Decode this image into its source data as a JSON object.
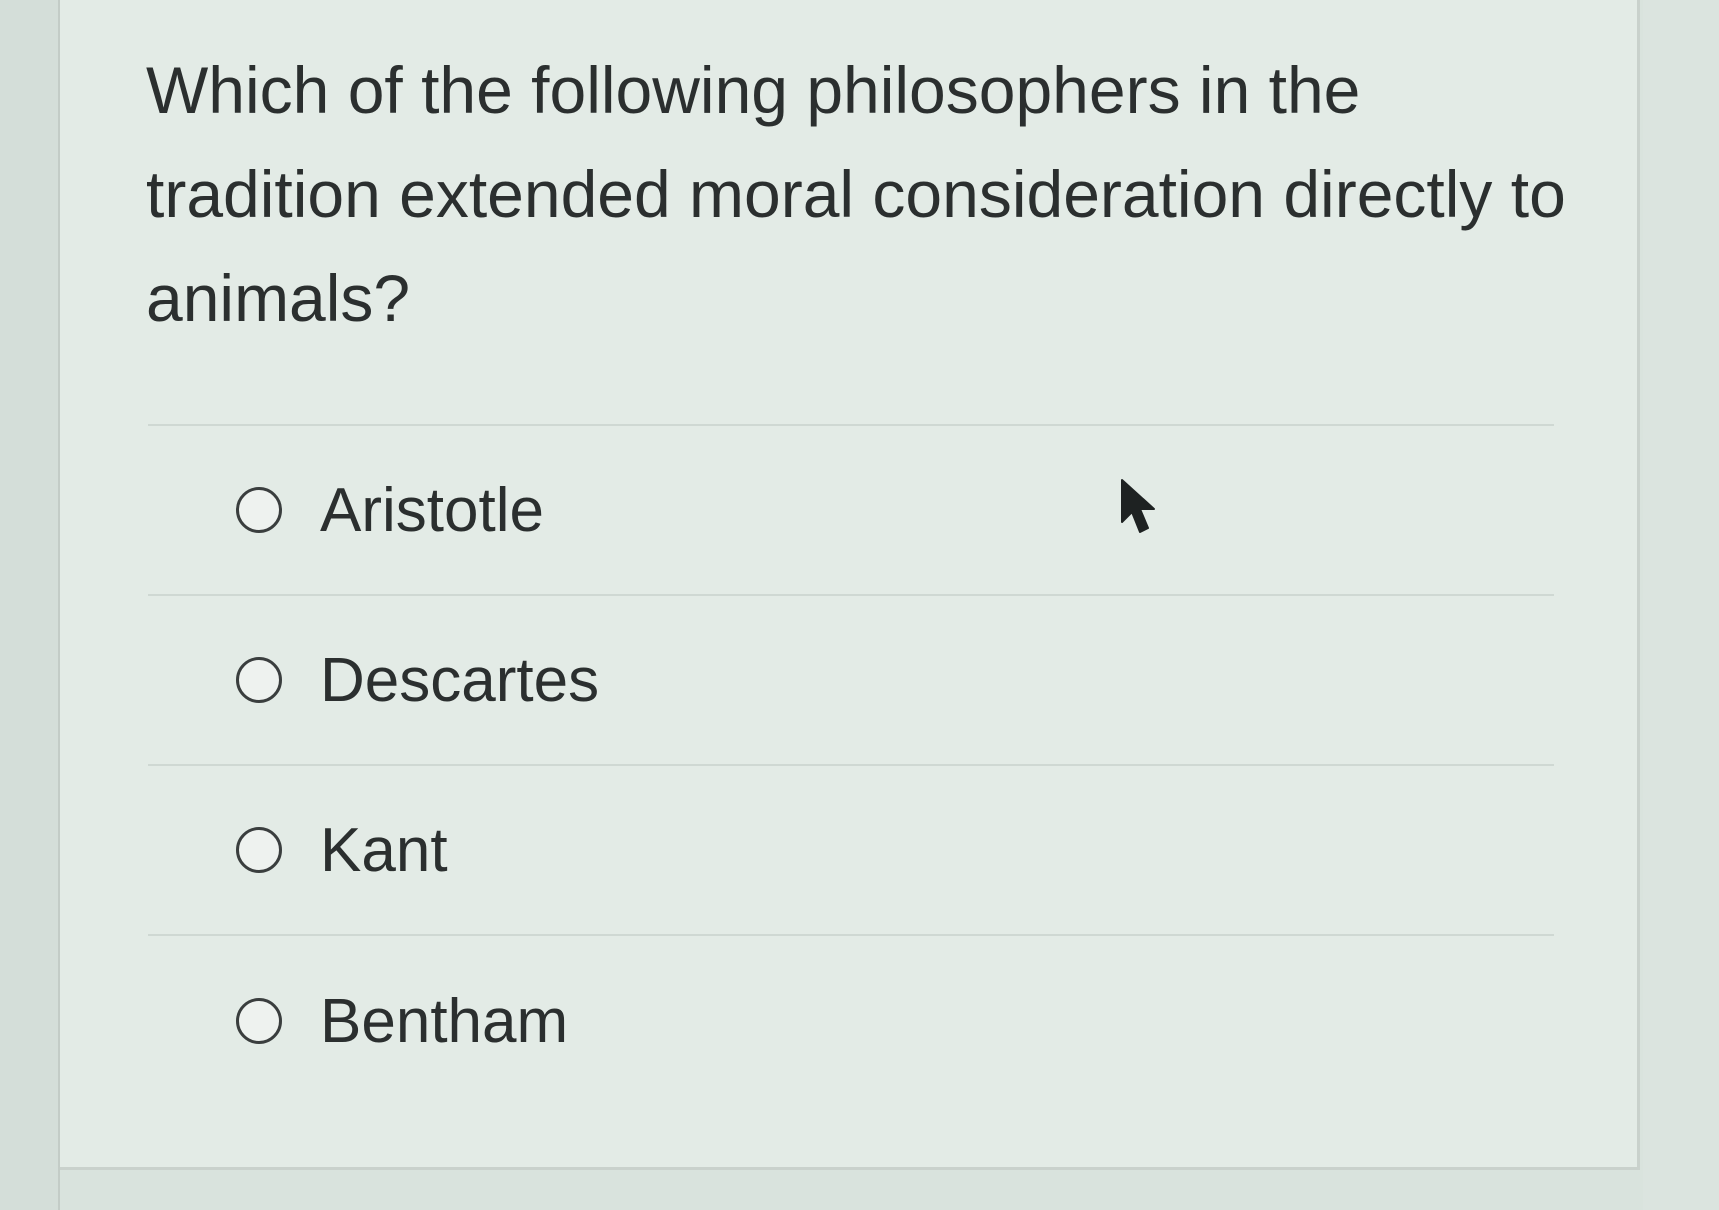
{
  "question": {
    "text": "Which of the following philosophers in the tradition extended moral consideration directly to animals?"
  },
  "options": [
    {
      "label": "Aristotle",
      "selected": false
    },
    {
      "label": "Descartes",
      "selected": false
    },
    {
      "label": "Kant",
      "selected": false
    },
    {
      "label": "Bentham",
      "selected": false
    }
  ],
  "cursor": {
    "icon": "arrow-cursor-icon"
  },
  "colors": {
    "background": "#e3ebe6",
    "text": "#2b2f2f",
    "divider": "#cfd8d3"
  }
}
